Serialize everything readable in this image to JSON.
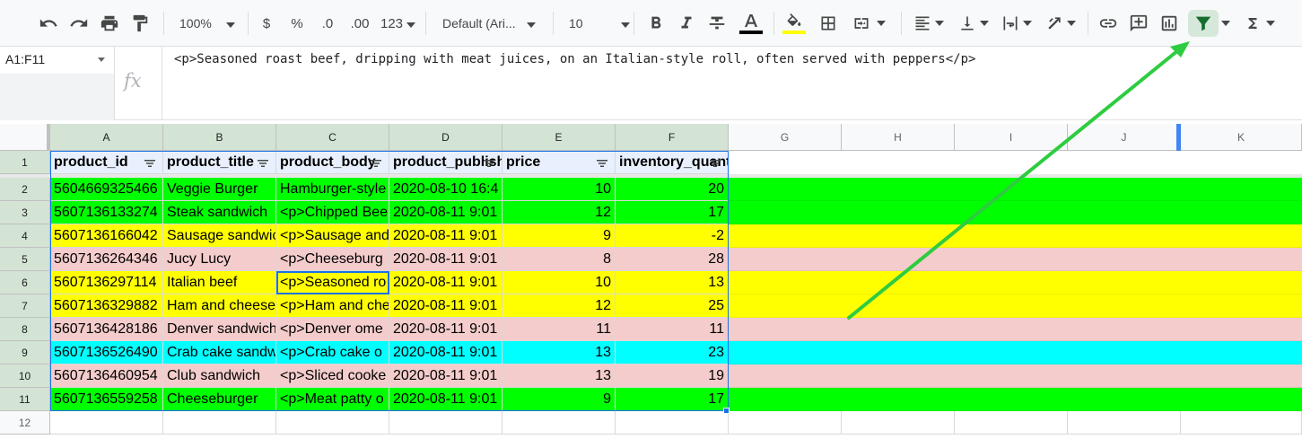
{
  "toolbar": {
    "zoom": "100%",
    "currency_label": "$",
    "percent_label": "%",
    "decrease_decimal_label": ".0",
    "increase_decimal_label": ".00",
    "more_formats_label": "123",
    "font_family": "Default (Ari...",
    "font_size": "10",
    "text_color": "#000000",
    "fill_color": "#ffff00"
  },
  "name_box": "A1:F11",
  "formula": "<p>Seasoned roast beef, dripping with meat juices, on an Italian-style roll, often served with peppers</p>",
  "columns": [
    "A",
    "B",
    "C",
    "D",
    "E",
    "F",
    "G",
    "H",
    "I",
    "J",
    "K"
  ],
  "row_numbers": [
    "1",
    "2",
    "3",
    "4",
    "5",
    "6",
    "7",
    "8",
    "9",
    "10",
    "11",
    "12"
  ],
  "header_row": [
    "product_id",
    "product_title",
    "product_body",
    "product_published",
    "price",
    "inventory_quantity"
  ],
  "rows": [
    {
      "cells": [
        "5604669325466",
        "Veggie Burger",
        "Hamburger-style",
        "2020-08-10 16:4",
        "10",
        "20"
      ],
      "color": "#00ff00"
    },
    {
      "cells": [
        "5607136133274",
        "Steak sandwich",
        "<p>Chipped Bee",
        "2020-08-11 9:01",
        "12",
        "17"
      ],
      "color": "#00ff00"
    },
    {
      "cells": [
        "5607136166042",
        "Sausage sandwich",
        "<p>Sausage and",
        "2020-08-11 9:01",
        "9",
        "-2"
      ],
      "color": "#ffff00"
    },
    {
      "cells": [
        "5607136264346",
        "Jucy Lucy",
        "<p>Cheeseburg",
        "2020-08-11 9:01",
        "8",
        "28"
      ],
      "color": "#f4cccc"
    },
    {
      "cells": [
        "5607136297114",
        "Italian beef",
        "<p>Seasoned ro",
        "2020-08-11 9:01",
        "10",
        "13"
      ],
      "color": "#ffff00"
    },
    {
      "cells": [
        "5607136329882",
        "Ham and cheese",
        "<p>Ham and che",
        "2020-08-11 9:01",
        "12",
        "25"
      ],
      "color": "#ffff00"
    },
    {
      "cells": [
        "5607136428186",
        "Denver sandwich",
        "<p>Denver ome",
        "2020-08-11 9:01",
        "11",
        "11"
      ],
      "color": "#f4cccc"
    },
    {
      "cells": [
        "5607136526490",
        "Crab cake sandwich",
        "<p>Crab cake o",
        "2020-08-11 9:01",
        "13",
        "23"
      ],
      "color": "#00ffff"
    },
    {
      "cells": [
        "5607136460954",
        "Club sandwich",
        "<p>Sliced cooke",
        "2020-08-11 9:01",
        "13",
        "19"
      ],
      "color": "#f4cccc"
    },
    {
      "cells": [
        "5607136559258",
        "Cheeseburger",
        "<p>Meat patty o",
        "2020-08-11 9:01",
        "9",
        "17"
      ],
      "color": "#00ff00"
    }
  ],
  "annotation_color": "#2ecc40"
}
